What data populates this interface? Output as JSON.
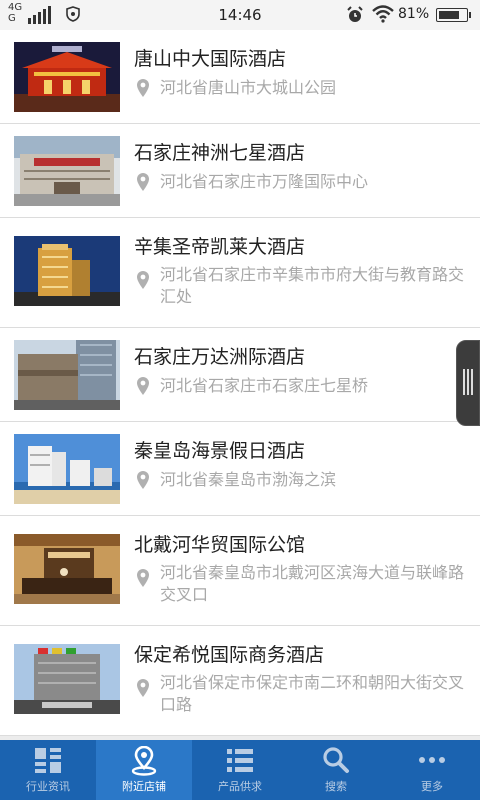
{
  "status_bar": {
    "network_top": "4G",
    "network_bottom": "G",
    "time": "14:46",
    "battery": "81%",
    "battery_level": 0.81
  },
  "hotels": [
    {
      "name": "唐山中大国际酒店",
      "address": "河北省唐山市大城山公园"
    },
    {
      "name": "石家庄神洲七星酒店",
      "address": "河北省石家庄市万隆国际中心"
    },
    {
      "name": "辛集圣帝凯莱大酒店",
      "address": "河北省石家庄市辛集市市府大街与教育路交汇处"
    },
    {
      "name": "石家庄万达洲际酒店",
      "address": "河北省石家庄市石家庄七星桥"
    },
    {
      "name": "秦皇岛海景假日酒店",
      "address": "河北省秦皇岛市渤海之滨"
    },
    {
      "name": "北戴河华贸国际公馆",
      "address": "河北省秦皇岛市北戴河区滨海大道与联峰路交叉口"
    },
    {
      "name": "保定希悦国际商务酒店",
      "address": "河北省保定市保定市南二环和朝阳大街交叉口路"
    }
  ],
  "tabs": [
    {
      "label": "行业资讯",
      "icon": "grid-icon"
    },
    {
      "label": "附近店铺",
      "icon": "location-pin-icon"
    },
    {
      "label": "产品供求",
      "icon": "list-icon"
    },
    {
      "label": "搜索",
      "icon": "search-icon"
    },
    {
      "label": "更多",
      "icon": "more-dots-icon"
    }
  ],
  "active_tab": 1,
  "colors": {
    "tab_bar": "#1b63b0",
    "tab_active": "#2b78c8",
    "title_text": "#222222",
    "address_text": "#a8a8a8"
  }
}
